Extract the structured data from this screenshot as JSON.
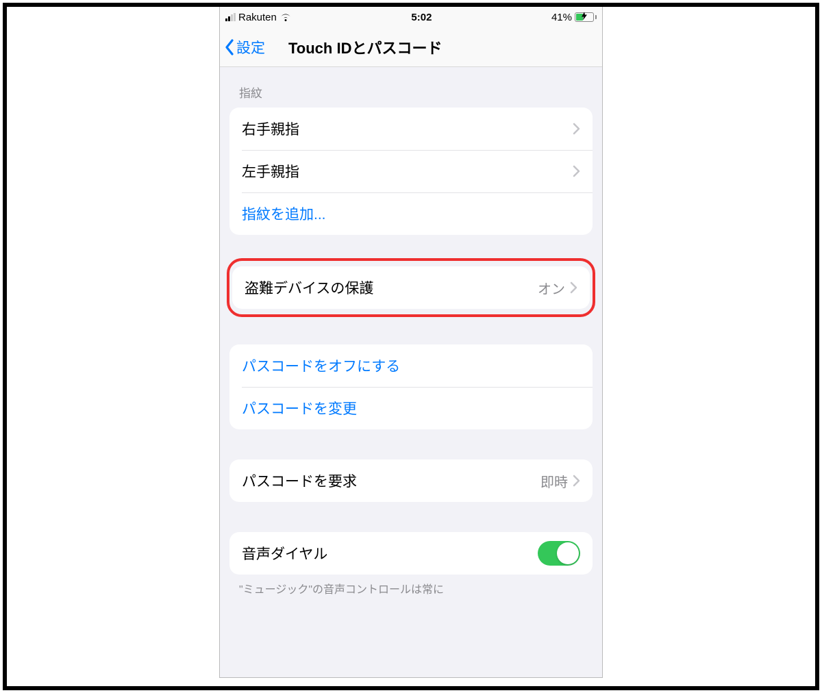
{
  "statusBar": {
    "carrier": "Rakuten",
    "time": "5:02",
    "batteryPercent": "41%"
  },
  "nav": {
    "backLabel": "設定",
    "title": "Touch IDとパスコード"
  },
  "sections": {
    "fingerprint": {
      "header": "指紋",
      "items": {
        "rightThumb": "右手親指",
        "leftThumb": "左手親指",
        "addFingerprint": "指紋を追加..."
      }
    },
    "stolenDevice": {
      "label": "盗難デバイスの保護",
      "value": "オン"
    },
    "passcode": {
      "turnOff": "パスコードをオフにする",
      "change": "パスコードを変更"
    },
    "requirePasscode": {
      "label": "パスコードを要求",
      "value": "即時"
    },
    "voiceDial": {
      "label": "音声ダイヤル",
      "toggle": true
    },
    "footer": "\"ミュージック\"の音声コントロールは常に"
  }
}
